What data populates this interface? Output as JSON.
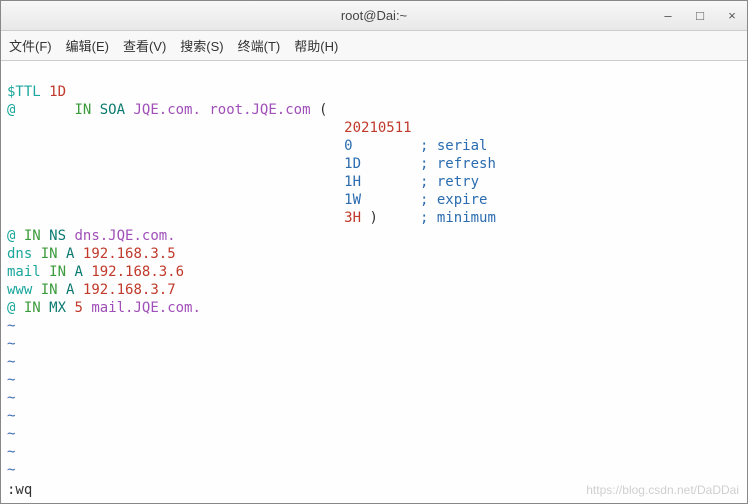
{
  "window": {
    "title": "root@Dai:~"
  },
  "menu": {
    "file": "文件(F)",
    "edit": "编辑(E)",
    "view": "查看(V)",
    "search": "搜索(S)",
    "terminal": "终端(T)",
    "help": "帮助(H)"
  },
  "zone": {
    "ttl_directive": "$TTL",
    "ttl_value": "1D",
    "origin": "@",
    "in": "IN",
    "soa": "SOA",
    "soa_primary": "JQE.com.",
    "soa_responsible": "root.JQE.com",
    "open_paren": "(",
    "serial_value": "20210511",
    "serial_line": "0        ; serial",
    "refresh_line": "1D       ; refresh",
    "retry_line": "1H       ; retry",
    "expire_line": "1W       ; expire",
    "minimum_value": "3H",
    "close_paren": ")",
    "minimum_comment": "; minimum",
    "ns_owner": "@",
    "ns_kw": "NS",
    "ns_target": "dns.JQE.com.",
    "a1_owner": "dns",
    "a_kw": "A",
    "a1_ip": "192.168.3.5",
    "a2_owner": "mail",
    "a2_ip": "192.168.3.6",
    "a3_owner": "www",
    "a3_ip": "192.168.3.7",
    "mx_owner": "@",
    "mx_kw": "MX",
    "mx_pri": "5",
    "mx_target": "mail.JQE.com."
  },
  "vi": {
    "tilde": "~",
    "cmd": ":wq"
  },
  "watermark": "https://blog.csdn.net/DaDDai"
}
